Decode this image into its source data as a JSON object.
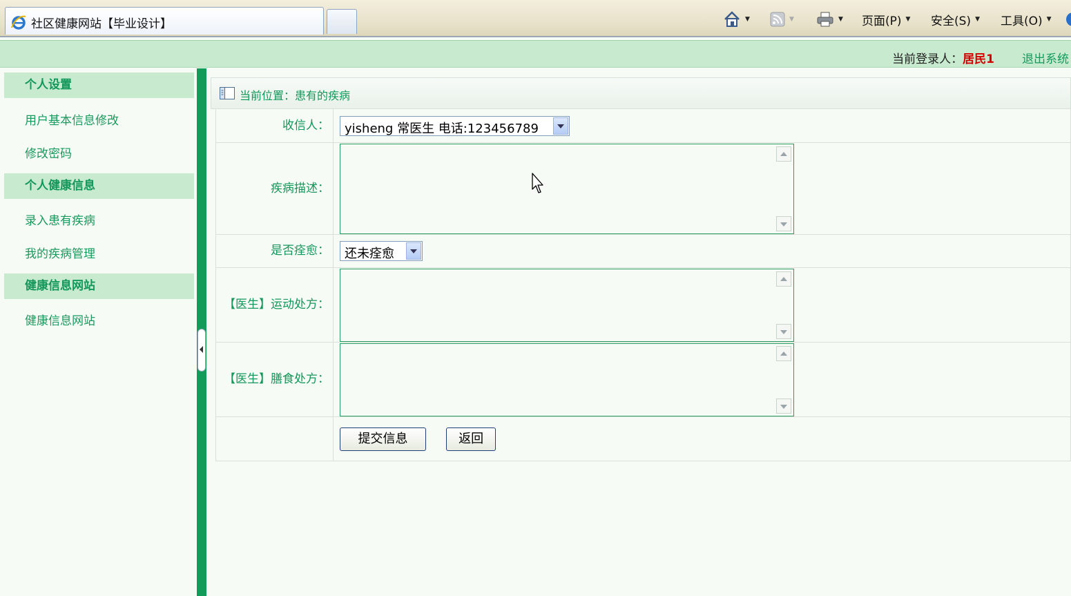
{
  "browser": {
    "tab_title": "社区健康网站【毕业设计】",
    "commands": {
      "page": "页面(P)",
      "safety": "安全(S)",
      "tools": "工具(O)"
    }
  },
  "header": {
    "login_label": "当前登录人：",
    "login_user": "居民1",
    "logout": "退出系统"
  },
  "sidebar": {
    "sections": [
      {
        "title": "个人设置",
        "items": [
          "用户基本信息修改",
          "修改密码"
        ]
      },
      {
        "title": "个人健康信息",
        "items": [
          "录入患有疾病",
          "我的疾病管理"
        ]
      },
      {
        "title": "健康信息网站",
        "items": [
          "健康信息网站"
        ]
      }
    ]
  },
  "breadcrumb": "当前位置：患有的疾病",
  "form": {
    "recipient": {
      "label": "收信人：",
      "selected": "yisheng 常医生  电话:123456789"
    },
    "disease_desc": {
      "label": "疾病描述：",
      "value": ""
    },
    "cured": {
      "label": "是否痊愈：",
      "selected": "还未痊愈"
    },
    "exercise": {
      "label": "【医生】运动处方：",
      "value": ""
    },
    "diet": {
      "label": "【医生】膳食处方：",
      "value": ""
    },
    "submit": "提交信息",
    "back": "返回"
  },
  "colors": {
    "accent_green": "#13975a",
    "header_green": "#c8ebcf",
    "user_red": "#d40000"
  }
}
